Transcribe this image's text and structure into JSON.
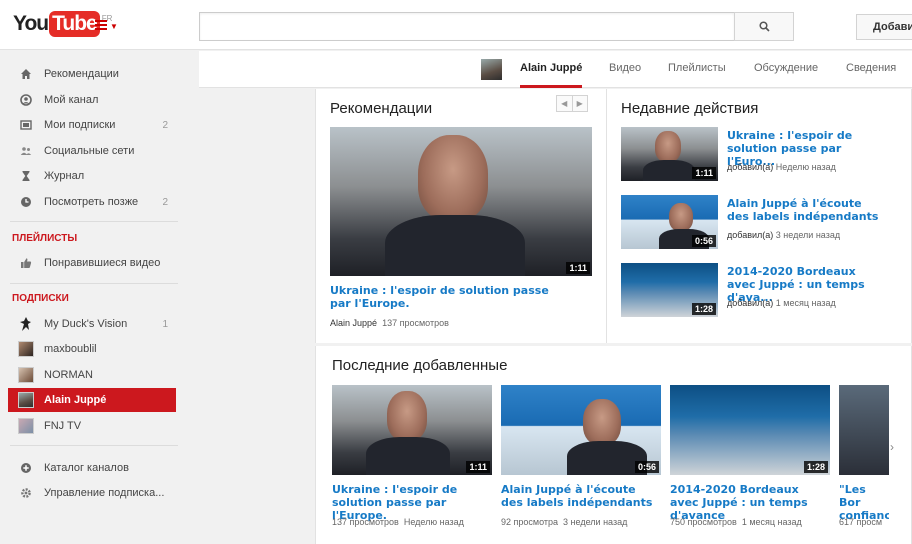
{
  "header": {
    "logo_you": "You",
    "logo_tube": "Tube",
    "region": "FR",
    "search_placeholder": "",
    "upload_label": "Добавить"
  },
  "sidebar": {
    "nav": [
      {
        "label": "Рекомендации",
        "icon": "home-icon",
        "count": ""
      },
      {
        "label": "Мой канал",
        "icon": "user-icon",
        "count": ""
      },
      {
        "label": "Мои подписки",
        "icon": "subscriptions-icon",
        "count": "2"
      },
      {
        "label": "Социальные сети",
        "icon": "social-icon",
        "count": ""
      },
      {
        "label": "Журнал",
        "icon": "history-icon",
        "count": ""
      },
      {
        "label": "Посмотреть позже",
        "icon": "clock-icon",
        "count": "2"
      }
    ],
    "playlists_title": "ПЛЕЙЛИСТЫ",
    "playlists": [
      {
        "label": "Понравившиеся видео",
        "icon": "thumbs-up-icon"
      }
    ],
    "subscriptions_title": "ПОДПИСКИ",
    "subscriptions": [
      {
        "label": "My Duck's Vision",
        "count": "1"
      },
      {
        "label": "maxboublil",
        "count": ""
      },
      {
        "label": "NORMAN",
        "count": ""
      },
      {
        "label": "Alain Juppé",
        "count": ""
      },
      {
        "label": "FNJ TV",
        "count": ""
      }
    ],
    "footer": [
      {
        "label": "Каталог каналов",
        "icon": "add-circle-icon"
      },
      {
        "label": "Управление подписка...",
        "icon": "gear-icon"
      }
    ]
  },
  "channel": {
    "name": "Alain Juppé",
    "tabs": [
      "Видео",
      "Плейлисты",
      "Обсуждение",
      "Сведения"
    ]
  },
  "recommended": {
    "title": "Рекомендации",
    "video": {
      "title": "Ukraine : l'espoir de solution passe par l'Europe.",
      "duration": "1:11",
      "author": "Alain Juppé",
      "views": "137 просмотров"
    }
  },
  "recent": {
    "title": "Недавние действия",
    "items": [
      {
        "title": "Ukraine : l'espoir de solution passe par l'Euro...",
        "duration": "1:11",
        "added_label": "добавил(а)",
        "when": "Неделю назад"
      },
      {
        "title": "Alain Juppé à l'écoute des labels indépendants",
        "duration": "0:56",
        "added_label": "добавил(а)",
        "when": "3 недели назад"
      },
      {
        "title": "2014-2020 Bordeaux avec Juppé : un temps d'ava...",
        "duration": "1:28",
        "added_label": "добавил(а)",
        "when": "1 месяц назад"
      }
    ]
  },
  "latest": {
    "title": "Последние добавленные",
    "items": [
      {
        "title": "Ukraine : l'espoir de solution passe par l'Europe.",
        "duration": "1:11",
        "views": "137 просмотров",
        "when": "Неделю назад"
      },
      {
        "title": "Alain Juppé à l'écoute des labels indépendants",
        "duration": "0:56",
        "views": "92 просмотра",
        "when": "3 недели назад"
      },
      {
        "title": "2014-2020 Bordeaux avec Juppé : un temps d'avance",
        "duration": "1:28",
        "views": "750 просмотров",
        "when": "1 месяц назад"
      },
      {
        "title": "\"Les Bor confianc",
        "duration": "",
        "views": "617 просм",
        "when": ""
      }
    ]
  }
}
